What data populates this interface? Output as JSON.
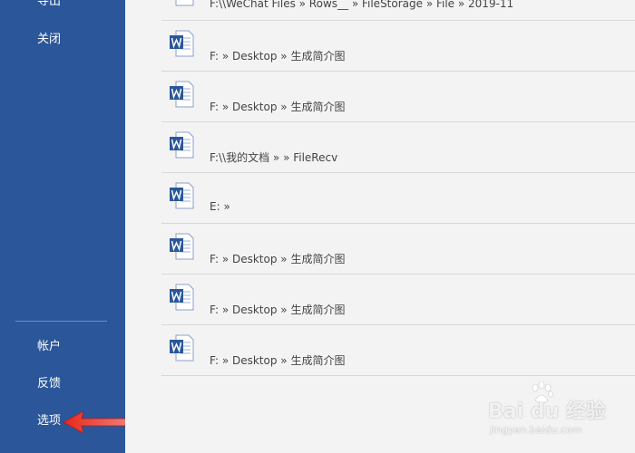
{
  "sidebar": {
    "items": {
      "export": "导出",
      "close": "关闭",
      "account": "帐户",
      "feedback": "反馈",
      "options": "选项"
    }
  },
  "recent_files": [
    {
      "icon": "word-doc-icon",
      "path": "F:\\\\WeChat Files » Rows__ » FileStorage » File » 2019-11"
    },
    {
      "icon": "word-doc-icon",
      "path": "F: » Desktop » 生成简介图"
    },
    {
      "icon": "word-doc-icon",
      "path": "F: » Desktop » 生成简介图"
    },
    {
      "icon": "word-doc-icon",
      "path": "F:\\\\我的文档 »                 » FileRecv"
    },
    {
      "icon": "word-doc-icon",
      "path": "E: »"
    },
    {
      "icon": "word-doc-icon",
      "path": "F: » Desktop » 生成简介图"
    },
    {
      "icon": "word-doc-icon",
      "path": "F: » Desktop » 生成简介图"
    },
    {
      "icon": "word-doc-icon",
      "path": "F: » Desktop » 生成简介图"
    }
  ],
  "watermark": {
    "brand": "Bai du 经验",
    "url": "jingyan.baidu.com"
  },
  "colors": {
    "sidebar_bg": "#2b579a",
    "main_bg": "#f3f3f3",
    "word_blue": "#2b579a",
    "arrow_red": "#e8271b"
  }
}
